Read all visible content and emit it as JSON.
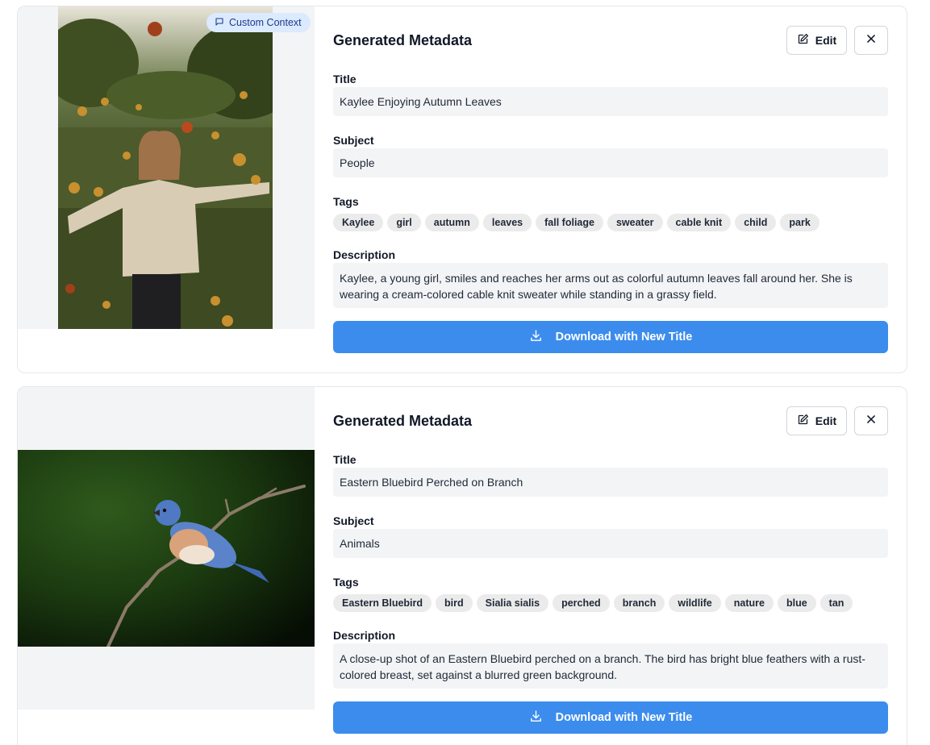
{
  "cards": [
    {
      "badge": "Custom Context",
      "panel_title": "Generated Metadata",
      "edit_label": "Edit",
      "title_label": "Title",
      "title_value": "Kaylee Enjoying Autumn Leaves",
      "subject_label": "Subject",
      "subject_value": "People",
      "tags_label": "Tags",
      "tags": [
        "Kaylee",
        "girl",
        "autumn",
        "leaves",
        "fall foliage",
        "sweater",
        "cable knit",
        "child",
        "park"
      ],
      "description_label": "Description",
      "description_value": "Kaylee, a young girl, smiles and reaches her arms out as colorful autumn leaves fall around her. She is wearing a cream-colored cable knit sweater while standing in a grassy field.",
      "download_label": "Download with New Title"
    },
    {
      "panel_title": "Generated Metadata",
      "edit_label": "Edit",
      "title_label": "Title",
      "title_value": "Eastern Bluebird Perched on Branch",
      "subject_label": "Subject",
      "subject_value": "Animals",
      "tags_label": "Tags",
      "tags": [
        "Eastern Bluebird",
        "bird",
        "Sialia sialis",
        "perched",
        "branch",
        "wildlife",
        "nature",
        "blue",
        "tan"
      ],
      "description_label": "Description",
      "description_value": "A close-up shot of an Eastern Bluebird perched on a branch. The bird has bright blue feathers with a rust-colored breast, set against a blurred green background.",
      "download_label": "Download with New Title"
    }
  ],
  "icons": {
    "badge": "message-square-icon",
    "edit": "pencil-square-icon",
    "close": "x-icon",
    "download": "download-icon"
  },
  "colors": {
    "primary_button": "#3b8ced",
    "badge_bg": "#dbeafe",
    "badge_text": "#1e3a8a",
    "field_bg": "#f3f4f6",
    "tag_bg": "#ebebeb"
  }
}
